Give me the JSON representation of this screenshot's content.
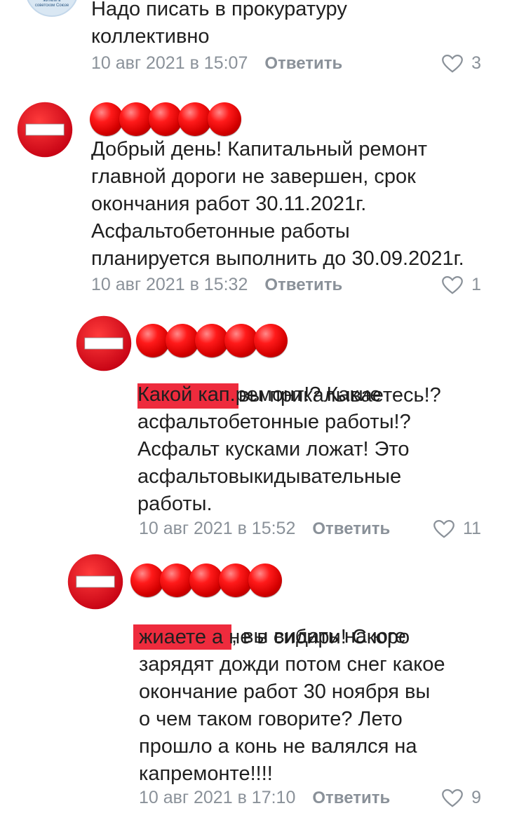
{
  "comments": [
    {
      "text": "Надо писать в прокуратуру\nколлективно",
      "date": "10 авг 2021 в 15:07",
      "reply": "Ответить",
      "likes": "3",
      "avatar_caption": "жители в\nсоветском Союзе"
    },
    {
      "text": "Добрый день! Капитальный ремонт\nглавной дороги не завершен, срок\nокончания работ 30.11.2021г.\nАсфальтобетонные работы\nпланируется выполнить до 30.09.2021г.",
      "date": "10 авг 2021 в 15:32",
      "reply": "Ответить",
      "likes": "1"
    },
    {
      "text_after_mask": "вы прикалываетесь!?",
      "text": "Какой кап.ремонт!? Какие\nасфальтобетонные работы!?\nАсфальт кусками ложат! Это\nасфальтовыкидывательные\nработы.",
      "date": "10 авг 2021 в 15:52",
      "reply": "Ответить",
      "likes": "11"
    },
    {
      "text_after_mask": ", вы видать на юге",
      "text": "жиаете а не в сибири! Скоро\nзарядят дожди потом снег какое\nокончание работ 30 ноября вы\nо чем таком говорите? Лето\nпрошло а конь не валялся на\nкапремонте!!!!",
      "date": "10 авг 2021 в 17:10",
      "reply": "Ответить",
      "likes": "9"
    }
  ],
  "colors": {
    "redaction": "#ee2b3d",
    "meta": "#8a9199",
    "stop_sign": "#e0001a"
  },
  "icons": {
    "avatar": "no-entry-sign-icon",
    "like": "heart-outline-icon"
  }
}
